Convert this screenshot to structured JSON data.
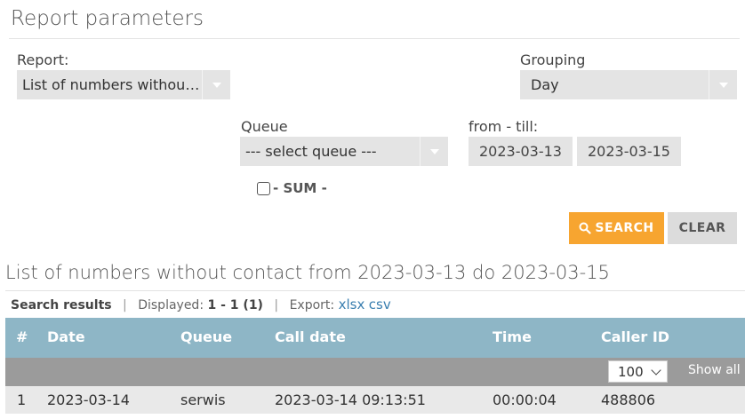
{
  "params": {
    "title": "Report parameters",
    "report_label": "Report:",
    "report_value": "List of numbers without...",
    "grouping_label": "Grouping",
    "grouping_value": "Day",
    "queue_label": "Queue",
    "queue_value": "--- select queue ---",
    "range_label": "from - till:",
    "date_from": "2023-03-13",
    "date_till": "2023-03-15",
    "sum_label": "- SUM -",
    "sum_checked": false,
    "search_label": "SEARCH",
    "clear_label": "CLEAR"
  },
  "results": {
    "title": "List of numbers without contact from 2023-03-13 do 2023-03-15",
    "search_results_label": "Search results",
    "displayed_label": "Displayed:",
    "displayed_value": "1 - 1 (1)",
    "export_label": "Export:",
    "export_xlsx": "xlsx",
    "export_csv": "csv",
    "columns": [
      "#",
      "Date",
      "Queue",
      "Call date",
      "Time",
      "Caller ID"
    ],
    "page_size": "100",
    "show_all": "Show all",
    "rows": [
      [
        "1",
        "2023-03-14",
        "serwis",
        "2023-03-14 09:13:51",
        "00:00:04",
        "488806"
      ]
    ]
  },
  "icons": {
    "search": "search-icon",
    "dropdown": "caret-down-icon"
  },
  "colors": {
    "accent": "#f7a530",
    "table_header": "#8eb6c6",
    "toolbar": "#9b9b9b",
    "link": "#3a7fb0"
  }
}
